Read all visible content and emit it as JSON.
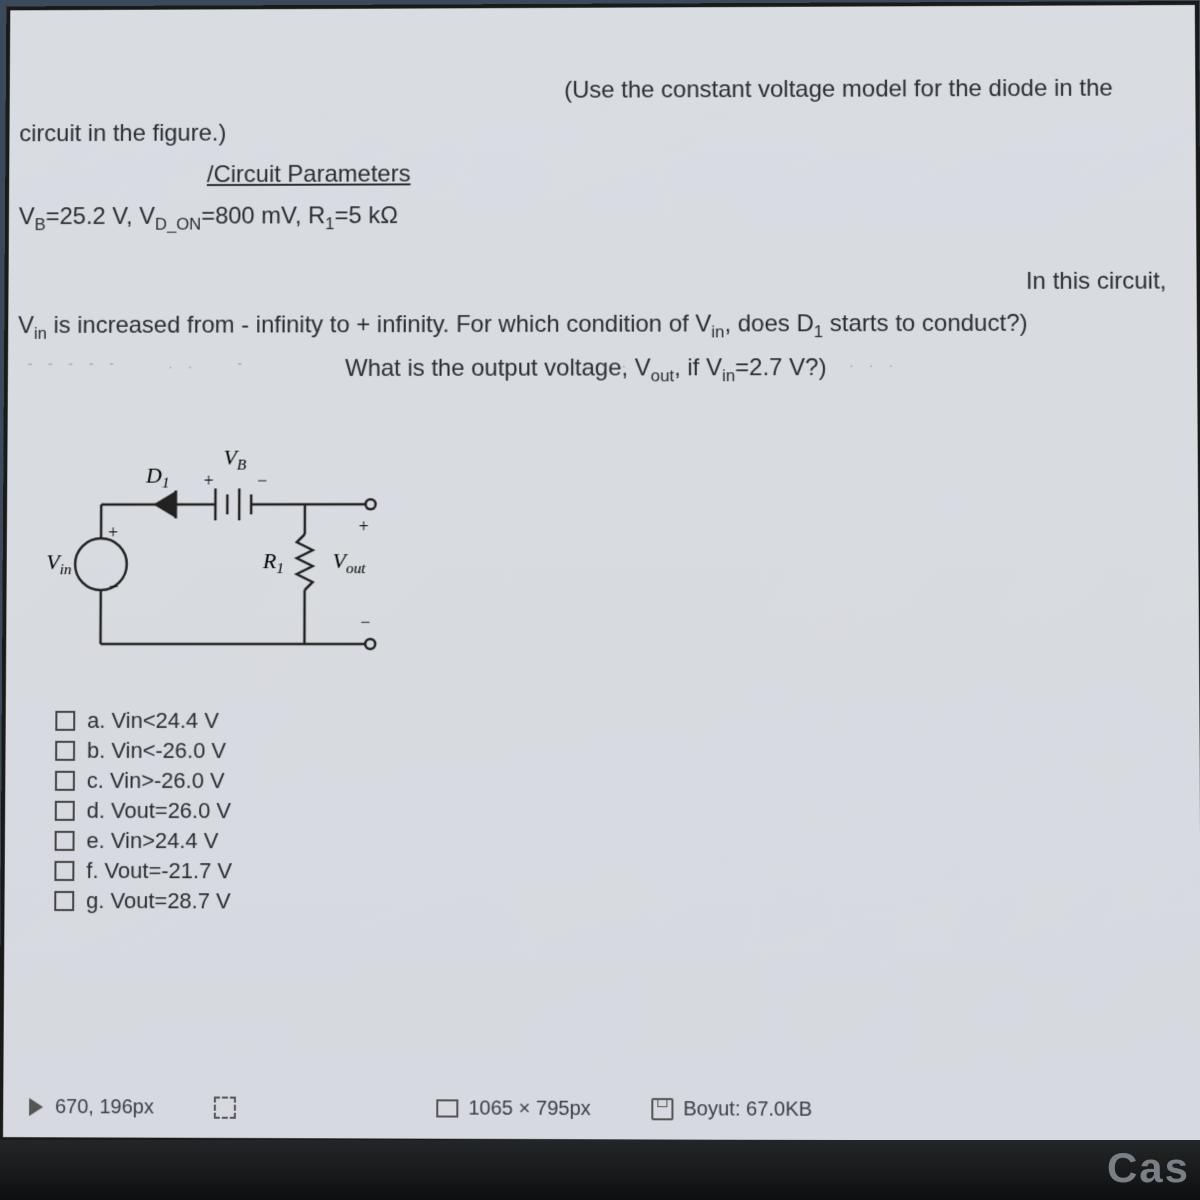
{
  "problem": {
    "lead_right": "(Use the constant voltage model for the diode in the",
    "lead_left": "circuit in the figure.)",
    "params_heading": "/Circuit Parameters",
    "params_line_html": "V<sub>B</sub>=25.2 V, V<sub>D_ON</sub>=800 mV, R<sub>1</sub>=5 kΩ",
    "tail_right": "In this circuit,",
    "question1_html": "V<sub>in</sub> is increased from - infinity to + infinity. For which condition of V<sub>in</sub>, does D<sub>1</sub> starts to conduct?)",
    "question2_html": "What is the output voltage, V<sub>out</sub>, if V<sub>in</sub>=2.7 V?)"
  },
  "circuit_labels": {
    "VB": "V",
    "VBsub": "B",
    "D1": "D",
    "D1sub": "1",
    "R1": "R",
    "R1sub": "1",
    "Vin": "V",
    "Vinsub": "in",
    "Vout": "V",
    "Voutsub": "out",
    "plus": "+",
    "minus": "−"
  },
  "options": [
    {
      "key": "a",
      "text": "Vin<24.4 V"
    },
    {
      "key": "b",
      "text": "Vin<-26.0 V"
    },
    {
      "key": "c",
      "text": "Vin>-26.0 V"
    },
    {
      "key": "d",
      "text": "Vout=26.0 V"
    },
    {
      "key": "e",
      "text": "Vin>24.4 V"
    },
    {
      "key": "f",
      "text": "Vout=-21.7 V"
    },
    {
      "key": "g",
      "text": "Vout=28.7 V"
    }
  ],
  "statusbar": {
    "cursor": "670, 196px",
    "dimensions": "1065 × 795px",
    "size_label": "Boyut: 67.0KB"
  },
  "brand": "Cas"
}
